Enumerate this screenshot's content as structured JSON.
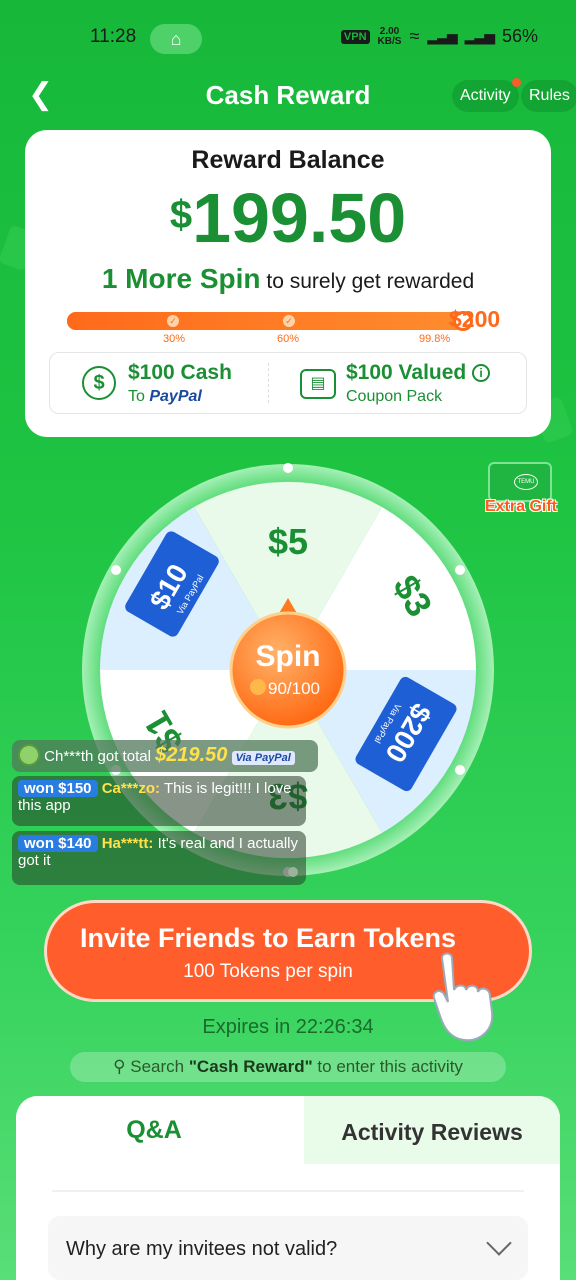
{
  "status": {
    "time": "11:28",
    "vpn": "VPN",
    "speed_top": "2.00",
    "speed_unit": "KB/S",
    "battery": "56%"
  },
  "header": {
    "title": "Cash Reward",
    "activity_label": "Activity",
    "rules_label": "Rules"
  },
  "balance": {
    "title": "Reward Balance",
    "currency": "$",
    "amount": "199.50",
    "spin_highlight": "1 More Spin",
    "spin_rest": "to surely get rewarded",
    "goal": "$200",
    "progress": 0.998,
    "milestones": [
      "30%",
      "60%",
      "99.8%"
    ]
  },
  "options": {
    "cash_title": "$100 Cash",
    "cash_to": "To",
    "cash_brand": "PayPal",
    "coupon_title": "$100 Valued",
    "coupon_sub": "Coupon Pack"
  },
  "wheel": {
    "segments": [
      "$5",
      "$3",
      "$200",
      "$3",
      "$1",
      "$10"
    ],
    "via_paypal": "Via PayPal",
    "spin_label": "Spin",
    "tokens": "90/100"
  },
  "extra_gift": {
    "label": "Extra Gift",
    "brand": "TEMU"
  },
  "feed": {
    "top": {
      "user": "Ch***th got total",
      "amount": "$219.50",
      "via": "Via",
      "brand": "PayPal"
    },
    "items": [
      {
        "won": "won $150",
        "user": "Ca***zo:",
        "text": "This is legit!!! I love this app"
      },
      {
        "won": "won $140",
        "user": "Ha***tt:",
        "text": "It's real and I actually got it"
      }
    ]
  },
  "invite": {
    "title": "Invite Friends to Earn Tokens",
    "subtitle": "100 Tokens per spin"
  },
  "expires": "Expires in 22:26:34",
  "search_hint": {
    "prefix": "Search",
    "keyword": "\"Cash Reward\"",
    "suffix": "to enter this activity"
  },
  "tabs": {
    "qa": "Q&A",
    "reviews": "Activity Reviews"
  },
  "faq": {
    "first_question": "Why are my invitees not valid?"
  },
  "colors": {
    "brand_green": "#1a8f33",
    "orange": "#ff5e2c",
    "bg_green": "#1fc443"
  }
}
